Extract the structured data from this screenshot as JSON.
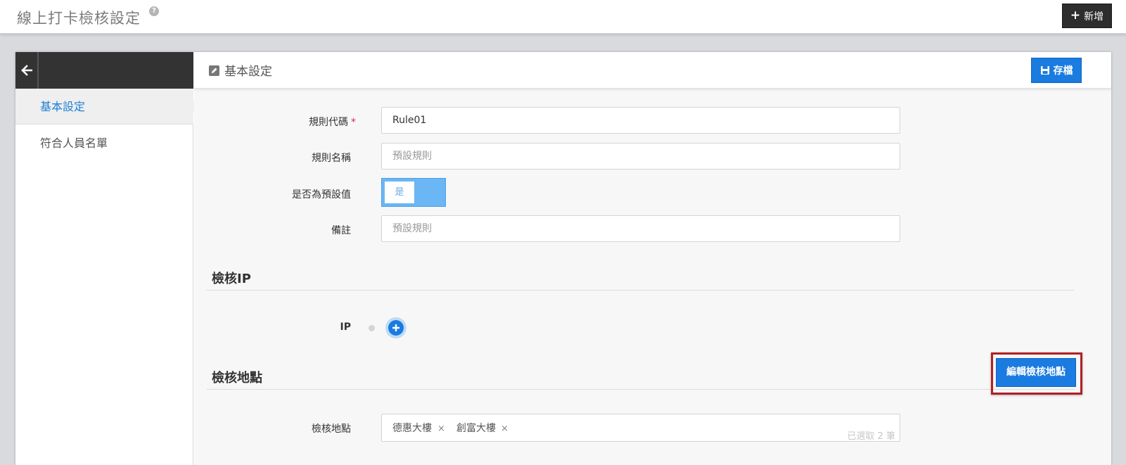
{
  "header": {
    "title": "線上打卡檢核設定",
    "help_icon": "question-circle-icon",
    "add_button": "新增",
    "add_icon": "plus-icon"
  },
  "sidebar": {
    "back_icon": "arrow-left-icon",
    "items": [
      {
        "label": "基本設定",
        "active": true
      },
      {
        "label": "符合人員名單",
        "active": false
      }
    ]
  },
  "content": {
    "section_title": "基本設定",
    "section_icon": "edit-icon",
    "save_button": "存檔",
    "save_icon": "floppy-disk-icon"
  },
  "form": {
    "rule_code_label": "規則代碼",
    "required_mark": "*",
    "rule_code_value": "Rule01",
    "rule_name_label": "規則名稱",
    "rule_name_placeholder": "預設規則",
    "default_label": "是否為預設值",
    "default_toggle_text": "是",
    "remark_label": "備註",
    "remark_placeholder": "預設規則"
  },
  "ip_section": {
    "heading": "檢核IP",
    "ip_label": "IP",
    "add_icon": "plus-circle-icon"
  },
  "location_section": {
    "heading": "檢核地點",
    "edit_button": "編輯檢核地點",
    "location_label": "檢核地點",
    "tags": [
      "德惠大樓",
      "創富大樓"
    ],
    "remove_glyph": "×",
    "selected_count": "已選取 2 筆"
  },
  "colors": {
    "primary": "#1a7be0",
    "active_text": "#1e7fd6",
    "dark_header": "#333333",
    "highlight_border": "#b31f24"
  }
}
